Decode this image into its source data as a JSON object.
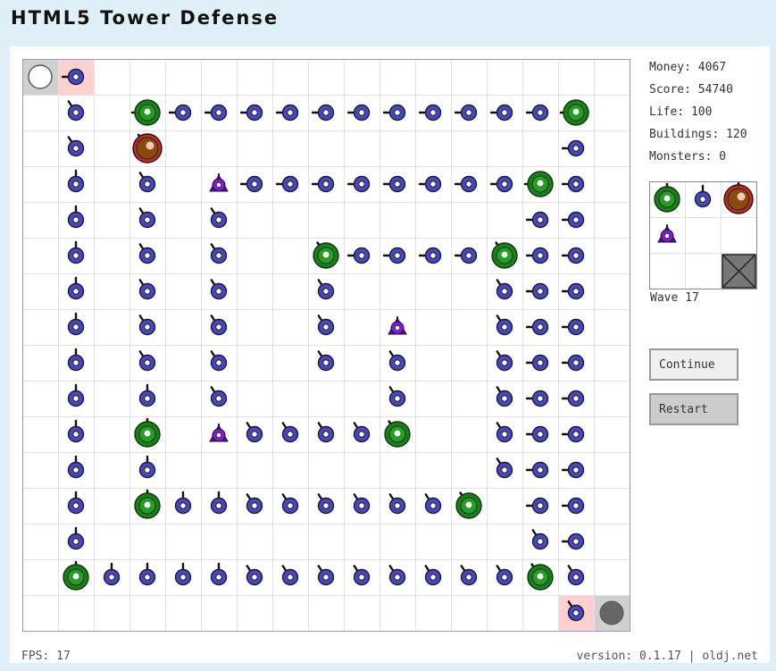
{
  "app": {
    "title": "HTML5 Tower Defense"
  },
  "stats": {
    "money_label": "Money:",
    "money": "4067",
    "score_label": "Score:",
    "score": "54740",
    "life_label": "Life:",
    "life": "100",
    "buildings_label": "Buildings:",
    "buildings": "120",
    "monsters_label": "Monsters:",
    "monsters": "0"
  },
  "wave": {
    "label": "Wave",
    "number": "17"
  },
  "buttons": {
    "continue": "Continue",
    "restart": "Restart"
  },
  "footer": {
    "fps_label": "FPS:",
    "fps": "17",
    "version": "version: 0.1.17 | oldj.net"
  },
  "colors": {
    "page_bg": "#dff0f8",
    "grid_line": "#e2e2e2",
    "board_border": "#9a9ab8",
    "cannon_fill": "#4848b8",
    "laser_fill": "#1d7d1d",
    "heavy_fill": "#8a4a0e",
    "enemy_fill": "#7a1fc4",
    "entrance_highlight": "#ffd0d0",
    "entrance_cell": "#d0d0d0",
    "exit_marker": "#666666"
  },
  "palette": {
    "items": [
      {
        "name": "laser-tower-option",
        "type": "laser"
      },
      {
        "name": "cannon-tower-option",
        "type": "cannon"
      },
      {
        "name": "heavy-tower-option",
        "type": "heavy"
      },
      {
        "name": "enemy-tower-option",
        "type": "enemy"
      },
      {
        "name": "empty-slot",
        "type": "empty"
      },
      {
        "name": "empty-slot",
        "type": "empty"
      },
      {
        "name": "empty-slot",
        "type": "empty"
      },
      {
        "name": "empty-slot",
        "type": "empty"
      },
      {
        "name": "delete-option",
        "type": "delete"
      }
    ]
  },
  "board": {
    "cols": 17,
    "rows": 16,
    "start_cell": {
      "col": 0,
      "row": 0
    },
    "end_cell": {
      "col": 16,
      "row": 15
    },
    "highlight_cells": [
      [
        1,
        0
      ],
      [
        15,
        15
      ]
    ],
    "towers": [
      {
        "col": 1,
        "row": 0,
        "type": "cannon",
        "dir": "w"
      },
      {
        "col": 15,
        "row": 15,
        "type": "cannon",
        "dir": "nw"
      },
      {
        "col": 1,
        "row": 1,
        "type": "cannon",
        "dir": "nw"
      },
      {
        "col": 3,
        "row": 1,
        "type": "laser",
        "dir": "w"
      },
      {
        "col": 4,
        "row": 1,
        "type": "cannon",
        "dir": "w"
      },
      {
        "col": 5,
        "row": 1,
        "type": "cannon",
        "dir": "w"
      },
      {
        "col": 6,
        "row": 1,
        "type": "cannon",
        "dir": "w"
      },
      {
        "col": 7,
        "row": 1,
        "type": "cannon",
        "dir": "w"
      },
      {
        "col": 8,
        "row": 1,
        "type": "cannon",
        "dir": "w"
      },
      {
        "col": 9,
        "row": 1,
        "type": "cannon",
        "dir": "w"
      },
      {
        "col": 10,
        "row": 1,
        "type": "cannon",
        "dir": "w"
      },
      {
        "col": 11,
        "row": 1,
        "type": "cannon",
        "dir": "w"
      },
      {
        "col": 12,
        "row": 1,
        "type": "cannon",
        "dir": "w"
      },
      {
        "col": 13,
        "row": 1,
        "type": "cannon",
        "dir": "w"
      },
      {
        "col": 14,
        "row": 1,
        "type": "cannon",
        "dir": "w"
      },
      {
        "col": 15,
        "row": 1,
        "type": "laser",
        "dir": "w"
      },
      {
        "col": 1,
        "row": 2,
        "type": "cannon",
        "dir": "nw"
      },
      {
        "col": 3,
        "row": 2,
        "type": "heavy",
        "dir": "nw"
      },
      {
        "col": 15,
        "row": 2,
        "type": "cannon",
        "dir": "w"
      },
      {
        "col": 1,
        "row": 3,
        "type": "cannon",
        "dir": "n"
      },
      {
        "col": 3,
        "row": 3,
        "type": "cannon",
        "dir": "nw"
      },
      {
        "col": 5,
        "row": 3,
        "type": "enemy",
        "dir": "n"
      },
      {
        "col": 6,
        "row": 3,
        "type": "cannon",
        "dir": "w"
      },
      {
        "col": 7,
        "row": 3,
        "type": "cannon",
        "dir": "w"
      },
      {
        "col": 8,
        "row": 3,
        "type": "cannon",
        "dir": "w"
      },
      {
        "col": 9,
        "row": 3,
        "type": "cannon",
        "dir": "w"
      },
      {
        "col": 10,
        "row": 3,
        "type": "cannon",
        "dir": "w"
      },
      {
        "col": 11,
        "row": 3,
        "type": "cannon",
        "dir": "w"
      },
      {
        "col": 12,
        "row": 3,
        "type": "cannon",
        "dir": "w"
      },
      {
        "col": 13,
        "row": 3,
        "type": "cannon",
        "dir": "w"
      },
      {
        "col": 14,
        "row": 3,
        "type": "laser",
        "dir": "w"
      },
      {
        "col": 15,
        "row": 3,
        "type": "cannon",
        "dir": "w"
      },
      {
        "col": 1,
        "row": 4,
        "type": "cannon",
        "dir": "n"
      },
      {
        "col": 3,
        "row": 4,
        "type": "cannon",
        "dir": "nw"
      },
      {
        "col": 5,
        "row": 4,
        "type": "cannon",
        "dir": "nw"
      },
      {
        "col": 14,
        "row": 4,
        "type": "cannon",
        "dir": "w"
      },
      {
        "col": 15,
        "row": 4,
        "type": "cannon",
        "dir": "w"
      },
      {
        "col": 1,
        "row": 5,
        "type": "cannon",
        "dir": "n"
      },
      {
        "col": 3,
        "row": 5,
        "type": "cannon",
        "dir": "nw"
      },
      {
        "col": 5,
        "row": 5,
        "type": "cannon",
        "dir": "nw"
      },
      {
        "col": 8,
        "row": 5,
        "type": "laser",
        "dir": "nw"
      },
      {
        "col": 9,
        "row": 5,
        "type": "cannon",
        "dir": "w"
      },
      {
        "col": 10,
        "row": 5,
        "type": "cannon",
        "dir": "w"
      },
      {
        "col": 11,
        "row": 5,
        "type": "cannon",
        "dir": "w"
      },
      {
        "col": 12,
        "row": 5,
        "type": "cannon",
        "dir": "w"
      },
      {
        "col": 13,
        "row": 5,
        "type": "laser",
        "dir": "nw"
      },
      {
        "col": 14,
        "row": 5,
        "type": "cannon",
        "dir": "w"
      },
      {
        "col": 15,
        "row": 5,
        "type": "cannon",
        "dir": "w"
      },
      {
        "col": 1,
        "row": 6,
        "type": "cannon",
        "dir": "n"
      },
      {
        "col": 3,
        "row": 6,
        "type": "cannon",
        "dir": "nw"
      },
      {
        "col": 5,
        "row": 6,
        "type": "cannon",
        "dir": "nw"
      },
      {
        "col": 8,
        "row": 6,
        "type": "cannon",
        "dir": "nw"
      },
      {
        "col": 13,
        "row": 6,
        "type": "cannon",
        "dir": "nw"
      },
      {
        "col": 14,
        "row": 6,
        "type": "cannon",
        "dir": "w"
      },
      {
        "col": 15,
        "row": 6,
        "type": "cannon",
        "dir": "w"
      },
      {
        "col": 1,
        "row": 7,
        "type": "cannon",
        "dir": "n"
      },
      {
        "col": 3,
        "row": 7,
        "type": "cannon",
        "dir": "nw"
      },
      {
        "col": 5,
        "row": 7,
        "type": "cannon",
        "dir": "nw"
      },
      {
        "col": 8,
        "row": 7,
        "type": "cannon",
        "dir": "nw"
      },
      {
        "col": 10,
        "row": 7,
        "type": "enemy",
        "dir": "n"
      },
      {
        "col": 13,
        "row": 7,
        "type": "cannon",
        "dir": "nw"
      },
      {
        "col": 14,
        "row": 7,
        "type": "cannon",
        "dir": "w"
      },
      {
        "col": 15,
        "row": 7,
        "type": "cannon",
        "dir": "w"
      },
      {
        "col": 1,
        "row": 8,
        "type": "cannon",
        "dir": "n"
      },
      {
        "col": 3,
        "row": 8,
        "type": "cannon",
        "dir": "nw"
      },
      {
        "col": 5,
        "row": 8,
        "type": "cannon",
        "dir": "nw"
      },
      {
        "col": 8,
        "row": 8,
        "type": "cannon",
        "dir": "nw"
      },
      {
        "col": 10,
        "row": 8,
        "type": "cannon",
        "dir": "nw"
      },
      {
        "col": 13,
        "row": 8,
        "type": "cannon",
        "dir": "nw"
      },
      {
        "col": 14,
        "row": 8,
        "type": "cannon",
        "dir": "w"
      },
      {
        "col": 15,
        "row": 8,
        "type": "cannon",
        "dir": "w"
      },
      {
        "col": 1,
        "row": 9,
        "type": "cannon",
        "dir": "n"
      },
      {
        "col": 3,
        "row": 9,
        "type": "cannon",
        "dir": "n"
      },
      {
        "col": 5,
        "row": 9,
        "type": "cannon",
        "dir": "nw"
      },
      {
        "col": 10,
        "row": 9,
        "type": "cannon",
        "dir": "nw"
      },
      {
        "col": 13,
        "row": 9,
        "type": "cannon",
        "dir": "nw"
      },
      {
        "col": 14,
        "row": 9,
        "type": "cannon",
        "dir": "w"
      },
      {
        "col": 15,
        "row": 9,
        "type": "cannon",
        "dir": "w"
      },
      {
        "col": 1,
        "row": 10,
        "type": "cannon",
        "dir": "n"
      },
      {
        "col": 3,
        "row": 10,
        "type": "laser",
        "dir": "n"
      },
      {
        "col": 5,
        "row": 10,
        "type": "enemy",
        "dir": "n"
      },
      {
        "col": 6,
        "row": 10,
        "type": "cannon",
        "dir": "nw"
      },
      {
        "col": 7,
        "row": 10,
        "type": "cannon",
        "dir": "nw"
      },
      {
        "col": 8,
        "row": 10,
        "type": "cannon",
        "dir": "nw"
      },
      {
        "col": 9,
        "row": 10,
        "type": "cannon",
        "dir": "nw"
      },
      {
        "col": 10,
        "row": 10,
        "type": "laser",
        "dir": "nw"
      },
      {
        "col": 13,
        "row": 10,
        "type": "cannon",
        "dir": "nw"
      },
      {
        "col": 14,
        "row": 10,
        "type": "cannon",
        "dir": "w"
      },
      {
        "col": 15,
        "row": 10,
        "type": "cannon",
        "dir": "w"
      },
      {
        "col": 1,
        "row": 11,
        "type": "cannon",
        "dir": "n"
      },
      {
        "col": 3,
        "row": 11,
        "type": "cannon",
        "dir": "n"
      },
      {
        "col": 13,
        "row": 11,
        "type": "cannon",
        "dir": "nw"
      },
      {
        "col": 14,
        "row": 11,
        "type": "cannon",
        "dir": "w"
      },
      {
        "col": 15,
        "row": 11,
        "type": "cannon",
        "dir": "w"
      },
      {
        "col": 1,
        "row": 12,
        "type": "cannon",
        "dir": "n"
      },
      {
        "col": 3,
        "row": 12,
        "type": "laser",
        "dir": "n"
      },
      {
        "col": 4,
        "row": 12,
        "type": "cannon",
        "dir": "n"
      },
      {
        "col": 5,
        "row": 12,
        "type": "cannon",
        "dir": "n"
      },
      {
        "col": 6,
        "row": 12,
        "type": "cannon",
        "dir": "nw"
      },
      {
        "col": 7,
        "row": 12,
        "type": "cannon",
        "dir": "nw"
      },
      {
        "col": 8,
        "row": 12,
        "type": "cannon",
        "dir": "nw"
      },
      {
        "col": 9,
        "row": 12,
        "type": "cannon",
        "dir": "nw"
      },
      {
        "col": 10,
        "row": 12,
        "type": "cannon",
        "dir": "nw"
      },
      {
        "col": 11,
        "row": 12,
        "type": "cannon",
        "dir": "nw"
      },
      {
        "col": 12,
        "row": 12,
        "type": "laser",
        "dir": "nw"
      },
      {
        "col": 14,
        "row": 12,
        "type": "cannon",
        "dir": "w"
      },
      {
        "col": 15,
        "row": 12,
        "type": "cannon",
        "dir": "w"
      },
      {
        "col": 1,
        "row": 13,
        "type": "cannon",
        "dir": "n"
      },
      {
        "col": 14,
        "row": 13,
        "type": "cannon",
        "dir": "nw"
      },
      {
        "col": 15,
        "row": 13,
        "type": "cannon",
        "dir": "w"
      },
      {
        "col": 1,
        "row": 14,
        "type": "laser",
        "dir": "n"
      },
      {
        "col": 2,
        "row": 14,
        "type": "cannon",
        "dir": "n"
      },
      {
        "col": 3,
        "row": 14,
        "type": "cannon",
        "dir": "n"
      },
      {
        "col": 4,
        "row": 14,
        "type": "cannon",
        "dir": "n"
      },
      {
        "col": 5,
        "row": 14,
        "type": "cannon",
        "dir": "n"
      },
      {
        "col": 6,
        "row": 14,
        "type": "cannon",
        "dir": "nw"
      },
      {
        "col": 7,
        "row": 14,
        "type": "cannon",
        "dir": "nw"
      },
      {
        "col": 8,
        "row": 14,
        "type": "cannon",
        "dir": "nw"
      },
      {
        "col": 9,
        "row": 14,
        "type": "cannon",
        "dir": "nw"
      },
      {
        "col": 10,
        "row": 14,
        "type": "cannon",
        "dir": "nw"
      },
      {
        "col": 11,
        "row": 14,
        "type": "cannon",
        "dir": "nw"
      },
      {
        "col": 12,
        "row": 14,
        "type": "cannon",
        "dir": "nw"
      },
      {
        "col": 13,
        "row": 14,
        "type": "cannon",
        "dir": "nw"
      },
      {
        "col": 14,
        "row": 14,
        "type": "laser",
        "dir": "nw"
      },
      {
        "col": 15,
        "row": 14,
        "type": "cannon",
        "dir": "nw"
      }
    ]
  }
}
